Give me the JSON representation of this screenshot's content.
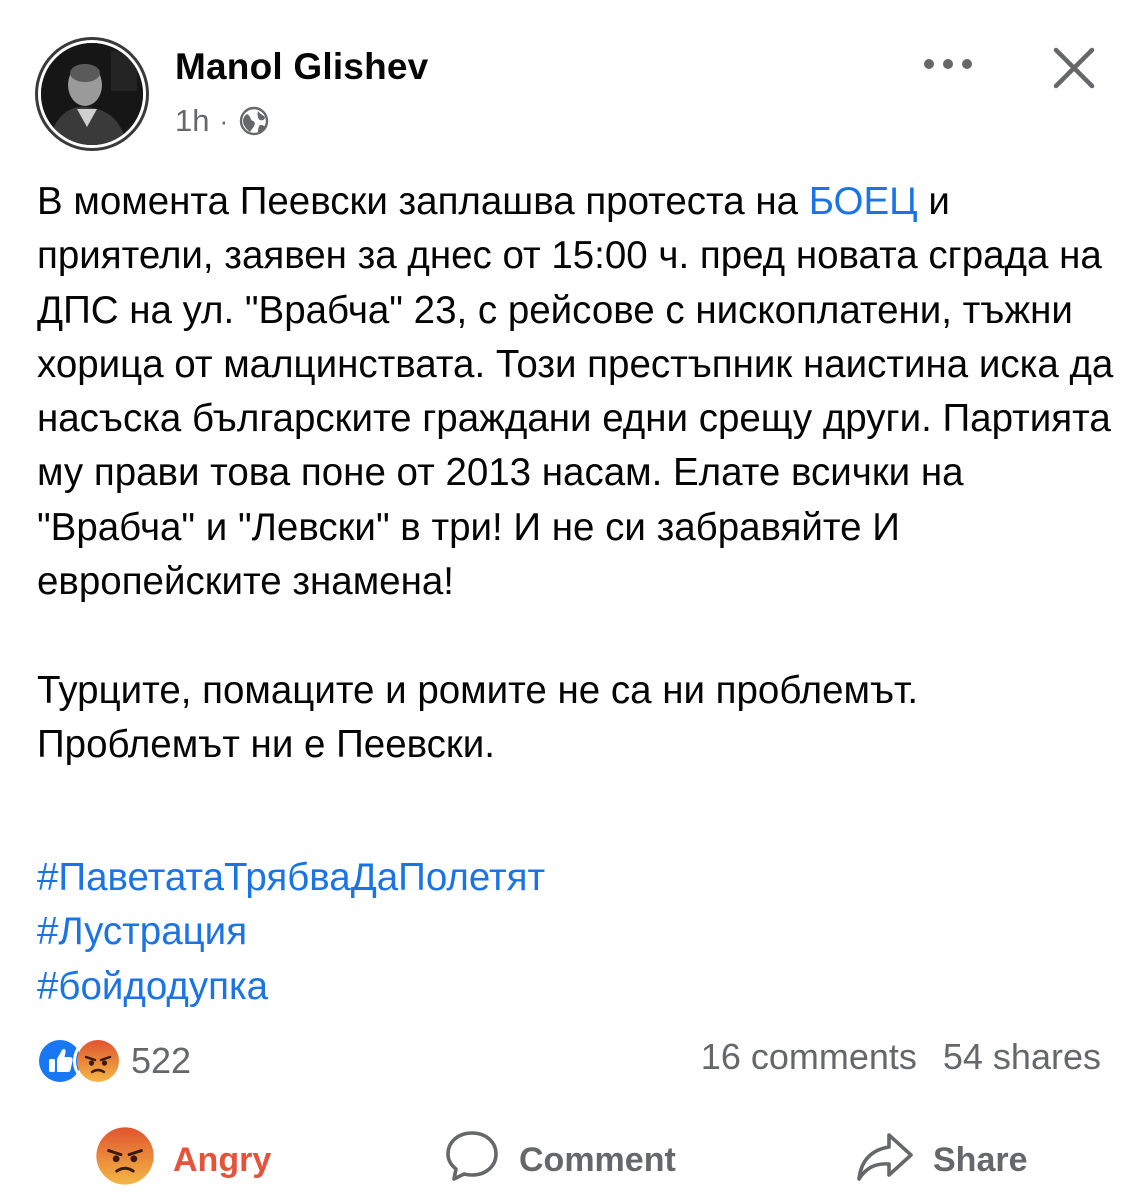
{
  "post": {
    "author": "Manol Glishev",
    "time": "1h",
    "separator": "·",
    "text_pre_link": "В момента Пеевски заплашва протеста на ",
    "link_text": "БОЕЦ",
    "text_post_link": " и приятели, заявен за днес от 15:00 ч. пред новата сграда на ДПС на ул. \"Врабча\" 23, с рейсове с нископлатени, тъжни хорица от малцинствата. Този престъпник наистина иска да насъска българските граждани едни срещу други. Партията му прави това поне от 2013 насам. Елате всички на \"Врабча\" и \"Левски\" в три! И не си забравяйте И европейските знамена!",
    "paragraph2": "Турците, помаците и ромите не са ни проблемът. Проблемът ни е Пеевски.",
    "hashtags": [
      "#ПаветатаТрябваДаПолетят",
      "#Лустрация",
      "#бойдодупка"
    ]
  },
  "stats": {
    "reaction_count": "522",
    "comments": "16 comments",
    "shares": "54 shares"
  },
  "actions": {
    "angry": "Angry",
    "comment": "Comment",
    "share": "Share"
  },
  "colors": {
    "link": "#1b74e4",
    "angry": "#e4533a",
    "muted": "#65676b",
    "like": "#1877f2"
  },
  "icons": [
    "avatar-photo",
    "globe-icon",
    "more-icon",
    "close-icon",
    "like-reaction-icon",
    "angry-reaction-icon",
    "comment-icon",
    "share-icon"
  ]
}
